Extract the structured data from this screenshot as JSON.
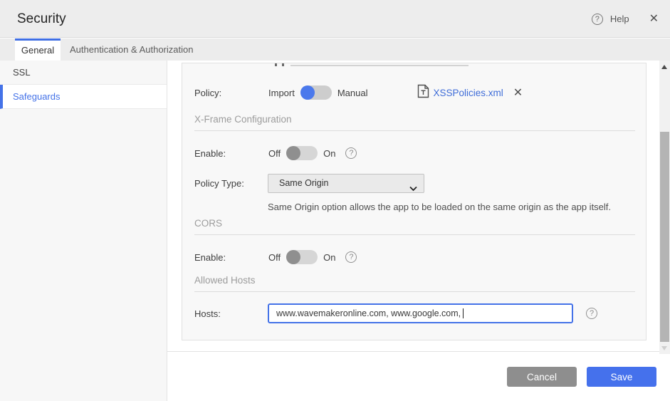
{
  "header": {
    "title": "Security",
    "help_label": "Help"
  },
  "icons": {
    "help_glyph": "?",
    "close_glyph": "✕"
  },
  "tabs": [
    {
      "label": "General",
      "active": true
    },
    {
      "label": "Authentication & Authorization",
      "active": false
    }
  ],
  "sidebar": {
    "items": [
      {
        "label": "SSL",
        "active": false
      },
      {
        "label": "Safeguards",
        "active": true
      }
    ]
  },
  "form": {
    "policy": {
      "label": "Policy:",
      "toggle_left": "Import",
      "toggle_right": "Manual",
      "toggle_state": "Import",
      "file_name": "XSSPolicies.xml"
    },
    "xframe": {
      "section_title": "X-Frame Configuration",
      "enable_label": "Enable:",
      "off_label": "Off",
      "on_label": "On",
      "enable_state": "Off",
      "policy_type_label": "Policy Type:",
      "policy_type_value": "Same Origin",
      "policy_type_description": "Same Origin option allows the app to be loaded on the same origin as the app itself."
    },
    "cors": {
      "section_title": "CORS",
      "enable_label": "Enable:",
      "off_label": "Off",
      "on_label": "On",
      "enable_state": "Off"
    },
    "allowed_hosts": {
      "section_title": "Allowed Hosts",
      "hosts_label": "Hosts:",
      "hosts_value": "www.wavemakeronline.com, www.google.com, "
    }
  },
  "footer": {
    "cancel_label": "Cancel",
    "save_label": "Save"
  },
  "colors": {
    "accent": "#4472e8",
    "link": "#3f6dd8",
    "save": "#4571ec",
    "cancel": "#8e8e8e"
  }
}
